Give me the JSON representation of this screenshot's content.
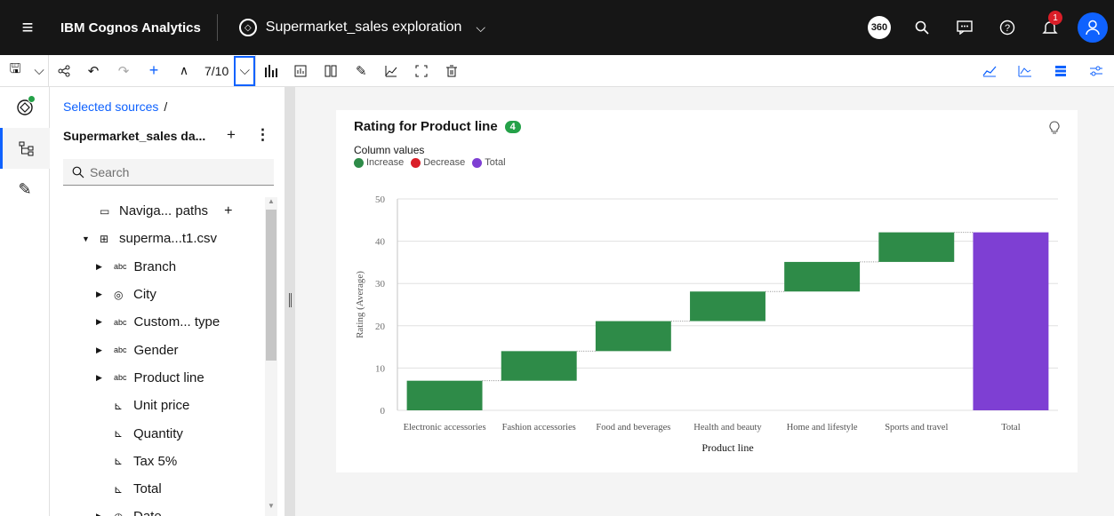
{
  "header": {
    "app_name_bold": "IBM Cognos Analytics",
    "document_title": "Supermarket_sales exploration",
    "badge_360": "360",
    "notifications_count": "1"
  },
  "toolbar": {
    "page_indicator": "7/10"
  },
  "sidebar": {
    "breadcrumb": "Selected sources",
    "breadcrumb_sep": "/",
    "source_name": "Supermarket_sales da...",
    "search": {
      "placeholder": "Search",
      "value": ""
    },
    "tree": [
      {
        "label": "Naviga... paths",
        "type": "folder",
        "level": 1,
        "has_add": true
      },
      {
        "label": "superma...t1.csv",
        "type": "table",
        "level": 1,
        "expanded": true
      },
      {
        "label": "Branch",
        "type": "abc",
        "level": 2
      },
      {
        "label": "City",
        "type": "geo",
        "level": 2
      },
      {
        "label": "Custom... type",
        "type": "abc",
        "level": 2
      },
      {
        "label": "Gender",
        "type": "abc",
        "level": 2
      },
      {
        "label": "Product line",
        "type": "abc",
        "level": 2
      },
      {
        "label": "Unit price",
        "type": "measure",
        "level": 2
      },
      {
        "label": "Quantity",
        "type": "measure",
        "level": 2
      },
      {
        "label": "Tax 5%",
        "type": "measure",
        "level": 2
      },
      {
        "label": "Total",
        "type": "measure",
        "level": 2
      },
      {
        "label": "Date",
        "type": "time",
        "level": 2
      }
    ]
  },
  "visualization": {
    "title": "Rating for Product line",
    "count_badge": "4",
    "legend_title": "Column values",
    "legend": [
      {
        "label": "Increase",
        "color": "#2e8b48"
      },
      {
        "label": "Decrease",
        "color": "#da1e28"
      },
      {
        "label": "Total",
        "color": "#7e3fd3"
      }
    ]
  },
  "chart_data": {
    "type": "bar",
    "subtype": "waterfall",
    "categories": [
      "Electronic accessories",
      "Fashion accessories",
      "Food and beverages",
      "Health and beauty",
      "Home and lifestyle",
      "Sports and travel",
      "Total"
    ],
    "values": [
      7.0,
      7.0,
      7.1,
      7.0,
      7.0,
      7.0,
      42.1
    ],
    "running_start": [
      0,
      7.0,
      14.0,
      21.1,
      28.1,
      35.1,
      0
    ],
    "running_end": [
      7.0,
      14.0,
      21.1,
      28.1,
      35.1,
      42.1,
      42.1
    ],
    "xlabel": "Product line",
    "ylabel": "Rating (Average)",
    "ylim": [
      0,
      50
    ],
    "yticks": [
      0,
      10,
      20,
      30,
      40,
      50
    ],
    "colors": {
      "increase": "#2e8b48",
      "total": "#7e3fd3"
    },
    "grid": true
  }
}
